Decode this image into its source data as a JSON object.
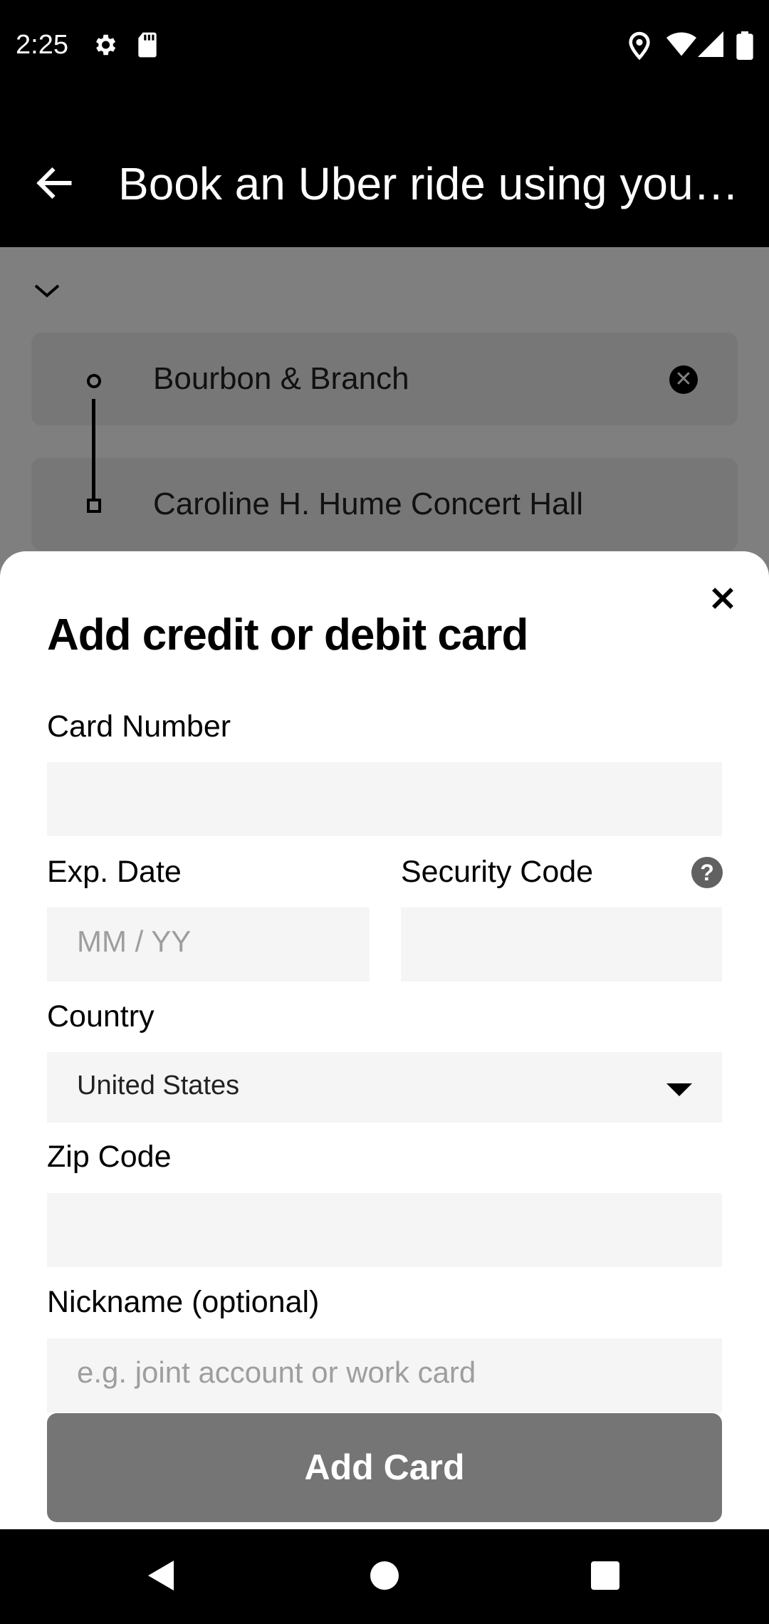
{
  "status_bar": {
    "time": "2:25",
    "left_icons": [
      "gear-icon",
      "sd-card-icon"
    ],
    "right_icons": [
      "location-icon",
      "wifi-icon",
      "signal-icon",
      "battery-icon"
    ]
  },
  "app_bar": {
    "back_icon": "arrow-back-icon",
    "title": "Book an Uber ride using your…"
  },
  "background": {
    "collapse_icon": "chevron-down-icon",
    "pickup": "Bourbon & Branch",
    "destination": "Caroline H. Hume Concert Hall",
    "clear_icon": "clear-icon"
  },
  "sheet": {
    "title": "Add credit or debit card",
    "close_icon": "close-icon",
    "card_number_label": "Card Number",
    "exp_date_label": "Exp. Date",
    "exp_date_placeholder": "MM / YY",
    "security_code_label": "Security Code",
    "help_icon_text": "?",
    "country_label": "Country",
    "country_value": "United States",
    "zip_label": "Zip Code",
    "nickname_label": "Nickname (optional)",
    "nickname_placeholder": "e.g. joint account or work card",
    "add_button": "Add Card"
  },
  "nav_bar": {
    "icons": [
      "back-triangle-icon",
      "home-circle-icon",
      "recents-square-icon"
    ]
  },
  "colors": {
    "button_disabled": "#757575",
    "field_bg": "#f5f5f5",
    "scrim": "rgba(0,0,0,0.5)"
  }
}
